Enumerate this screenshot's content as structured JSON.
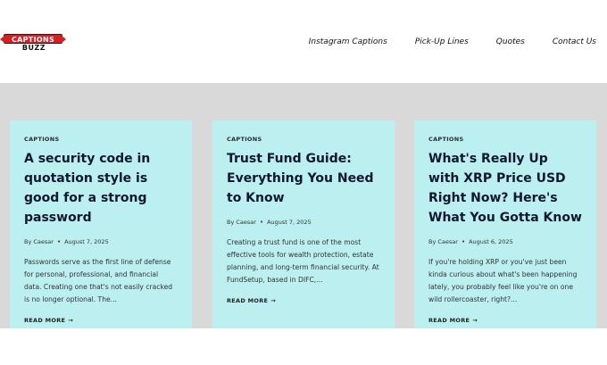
{
  "brand": {
    "logo_top": "CAPTIONS",
    "logo_bottom": "BUZZ",
    "accent": "#d81d23"
  },
  "nav": {
    "items": [
      {
        "label": "Instagram Captions"
      },
      {
        "label": "Pick-Up Lines"
      },
      {
        "label": "Quotes"
      },
      {
        "label": "Contact Us"
      }
    ]
  },
  "colors": {
    "content_bg": "#d9d9d9",
    "card_bg": "#bcefef",
    "title": "#101830"
  },
  "posts": [
    {
      "category": "CAPTIONS",
      "title": "A security code in quotation style is good for a strong password",
      "author": "By Caesar",
      "date": "August 7, 2025",
      "excerpt": "Passwords serve as the first line of defense for personal, professional, and financial data. Creating one that's not easily cracked is no longer optional. The...",
      "read_more": "READ MORE",
      "arrow": "→"
    },
    {
      "category": "CAPTIONS",
      "title": "Trust Fund Guide: Everything You Need to Know",
      "author": "By Caesar",
      "date": "August 7, 2025",
      "excerpt": "Creating a trust fund is one of the most effective tools for wealth protection, estate planning, and long-term financial security. At FundSetup, based in DIFC,...",
      "read_more": "READ MORE",
      "arrow": "→"
    },
    {
      "category": "CAPTIONS",
      "title": "What's Really Up with XRP Price USD Right Now? Here's What You Gotta Know",
      "author": "By Caesar",
      "date": "August 6, 2025",
      "excerpt": "If you're holding XRP or you've just been kinda curious about what's been happening lately, you probably feel like you're on one wild rollercoaster, right?...",
      "read_more": "READ MORE",
      "arrow": "→"
    }
  ]
}
